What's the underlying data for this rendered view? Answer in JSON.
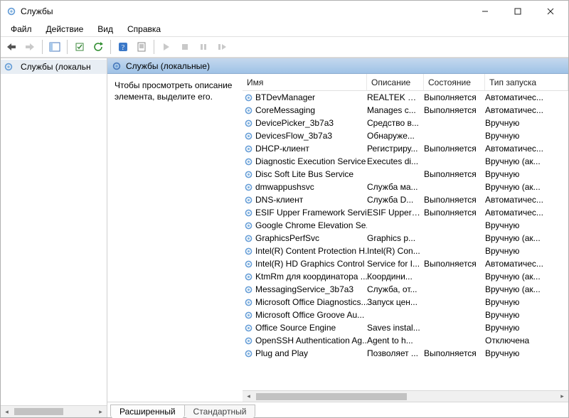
{
  "window": {
    "title": "Службы"
  },
  "menu": {
    "file": "Файл",
    "action": "Действие",
    "view": "Вид",
    "help": "Справка"
  },
  "tree": {
    "item0": "Службы (локальн"
  },
  "pane": {
    "header": "Службы (локальные)"
  },
  "desc": {
    "text": "Чтобы просмотреть описание элемента, выделите его."
  },
  "columns": {
    "name": "Имя",
    "desc": "Описание",
    "state": "Состояние",
    "start": "Тип запуска"
  },
  "tabs": {
    "extended": "Расширенный",
    "standard": "Стандартный"
  },
  "services": [
    {
      "name": "BTDevManager",
      "desc": "REALTEK BI...",
      "state": "Выполняется",
      "start": "Автоматичес..."
    },
    {
      "name": "CoreMessaging",
      "desc": "Manages c...",
      "state": "Выполняется",
      "start": "Автоматичес..."
    },
    {
      "name": "DevicePicker_3b7a3",
      "desc": "Средство в...",
      "state": "",
      "start": "Вручную"
    },
    {
      "name": "DevicesFlow_3b7a3",
      "desc": "Обнаруже...",
      "state": "",
      "start": "Вручную"
    },
    {
      "name": "DHCP-клиент",
      "desc": "Регистриру...",
      "state": "Выполняется",
      "start": "Автоматичес..."
    },
    {
      "name": "Diagnostic Execution Service",
      "desc": "Executes di...",
      "state": "",
      "start": "Вручную (ак..."
    },
    {
      "name": "Disc Soft Lite Bus Service",
      "desc": "",
      "state": "Выполняется",
      "start": "Вручную"
    },
    {
      "name": "dmwappushsvc",
      "desc": "Служба ма...",
      "state": "",
      "start": "Вручную (ак..."
    },
    {
      "name": "DNS-клиент",
      "desc": "Служба D...",
      "state": "Выполняется",
      "start": "Автоматичес..."
    },
    {
      "name": "ESIF Upper Framework Service",
      "desc": "ESIF Upper ...",
      "state": "Выполняется",
      "start": "Автоматичес..."
    },
    {
      "name": "Google Chrome Elevation Se...",
      "desc": "",
      "state": "",
      "start": "Вручную"
    },
    {
      "name": "GraphicsPerfSvc",
      "desc": "Graphics p...",
      "state": "",
      "start": "Вручную (ак..."
    },
    {
      "name": "Intel(R) Content Protection H...",
      "desc": "Intel(R) Con...",
      "state": "",
      "start": "Вручную"
    },
    {
      "name": "Intel(R) HD Graphics Control ...",
      "desc": "Service for I...",
      "state": "Выполняется",
      "start": "Автоматичес..."
    },
    {
      "name": "KtmRm для координатора ...",
      "desc": "Координи...",
      "state": "",
      "start": "Вручную (ак..."
    },
    {
      "name": "MessagingService_3b7a3",
      "desc": "Служба, от...",
      "state": "",
      "start": "Вручную (ак..."
    },
    {
      "name": "Microsoft Office Diagnostics...",
      "desc": "Запуск цен...",
      "state": "",
      "start": "Вручную"
    },
    {
      "name": "Microsoft Office Groove Au...",
      "desc": "",
      "state": "",
      "start": "Вручную"
    },
    {
      "name": "Office  Source Engine",
      "desc": "Saves instal...",
      "state": "",
      "start": "Вручную"
    },
    {
      "name": "OpenSSH Authentication Ag...",
      "desc": "Agent to h...",
      "state": "",
      "start": "Отключена"
    },
    {
      "name": "Plug and Play",
      "desc": "Позволяет ...",
      "state": "Выполняется",
      "start": "Вручную"
    }
  ]
}
